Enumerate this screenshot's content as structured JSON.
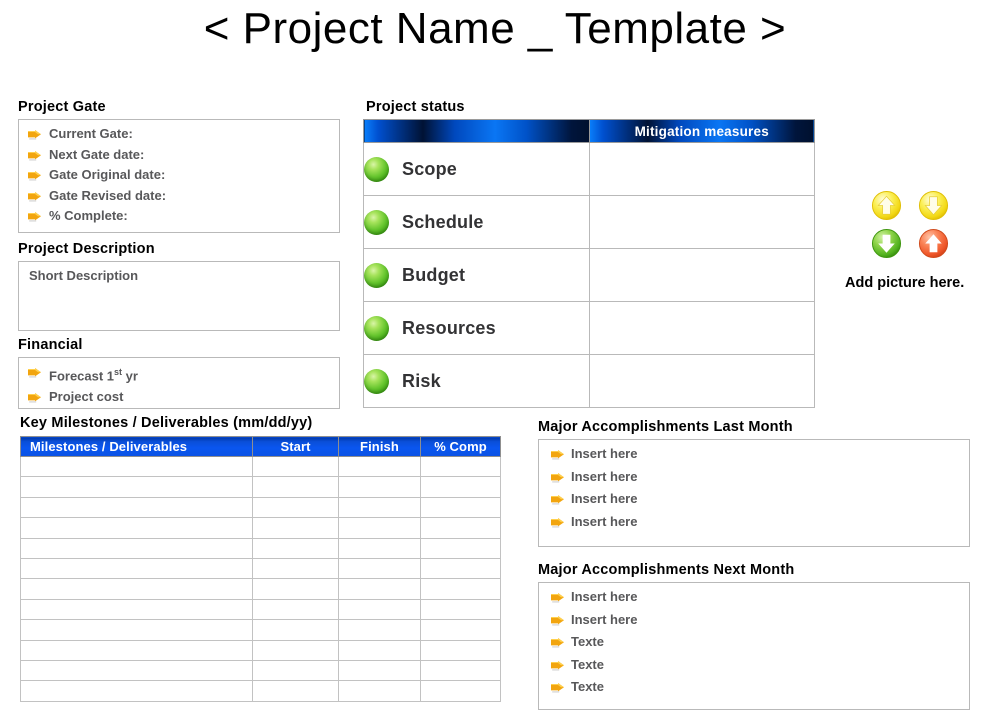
{
  "title": "< Project Name _ Template >",
  "project_gate": {
    "heading": "Project Gate",
    "items": [
      "Current Gate:",
      "Next Gate date:",
      "Gate Original date:",
      "Gate Revised date:",
      "%  Complete:"
    ]
  },
  "project_description": {
    "heading": "Project Description",
    "text": "Short Description"
  },
  "financial": {
    "heading": "Financial",
    "items": [
      {
        "text": "Forecast 1",
        "sup": "st",
        "tail": " yr"
      },
      {
        "text": "Project cost",
        "sup": "",
        "tail": ""
      }
    ]
  },
  "project_status": {
    "heading": "Project status",
    "column_header": "Mitigation measures",
    "rows": [
      {
        "name": "Scope",
        "status_color": "#5ec12a",
        "mitigation": ""
      },
      {
        "name": "Schedule",
        "status_color": "#5ec12a",
        "mitigation": ""
      },
      {
        "name": "Budget",
        "status_color": "#5ec12a",
        "mitigation": ""
      },
      {
        "name": "Resources",
        "status_color": "#5ec12a",
        "mitigation": ""
      },
      {
        "name": "Risk",
        "status_color": "#5ec12a",
        "mitigation": ""
      }
    ]
  },
  "picture_area": {
    "label": "Add  picture  here.",
    "icons": [
      {
        "name": "arrow-up-yellow-icon",
        "direction": "up",
        "color": "#f5dc1e"
      },
      {
        "name": "arrow-down-yellow-icon",
        "direction": "down",
        "color": "#f5dc1e"
      },
      {
        "name": "arrow-down-green-icon",
        "direction": "down",
        "color": "#4fb327"
      },
      {
        "name": "arrow-up-red-icon",
        "direction": "up",
        "color": "#ef5f33"
      }
    ]
  },
  "milestones": {
    "heading": "Key Milestones  / Deliverables  (mm/dd/yy)",
    "columns": [
      "Milestones / Deliverables",
      "Start",
      "Finish",
      "% Comp"
    ],
    "row_count": 12,
    "rows": [
      [
        "",
        "",
        "",
        ""
      ],
      [
        "",
        "",
        "",
        ""
      ],
      [
        "",
        "",
        "",
        ""
      ],
      [
        "",
        "",
        "",
        ""
      ],
      [
        "",
        "",
        "",
        ""
      ],
      [
        "",
        "",
        "",
        ""
      ],
      [
        "",
        "",
        "",
        ""
      ],
      [
        "",
        "",
        "",
        ""
      ],
      [
        "",
        "",
        "",
        ""
      ],
      [
        "",
        "",
        "",
        ""
      ],
      [
        "",
        "",
        "",
        ""
      ],
      [
        "",
        "",
        "",
        ""
      ]
    ]
  },
  "accomplishments_last_month": {
    "heading": "Major  Accomplishments  Last Month",
    "items": [
      "Insert here",
      "Insert here",
      "Insert here",
      "Insert here"
    ]
  },
  "accomplishments_next_month": {
    "heading": "Major  Accomplishments  Next Month",
    "items": [
      "Insert here",
      "Insert here",
      "Texte",
      "Texte",
      "Texte"
    ]
  },
  "colors": {
    "header_blue": "#0b52e4",
    "header_navy": "#00102e",
    "bullet_orange": "#f0a818",
    "status_green": "#5ec12a",
    "text_gray": "#58585a",
    "panel_border": "#b9b9b9"
  }
}
